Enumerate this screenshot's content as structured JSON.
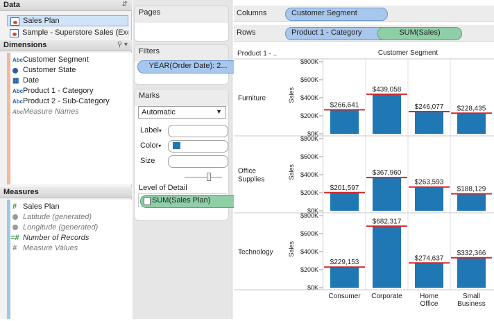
{
  "datapane": {
    "title": "Data",
    "sources": [
      {
        "label": "Sales Plan",
        "selected": true
      },
      {
        "label": "Sample - Superstore Sales (Exc..."
      }
    ],
    "dimensions_title": "Dimensions",
    "dimensions": [
      {
        "label": "Customer Segment",
        "icon": "Abc",
        "linked": true
      },
      {
        "label": "Customer State",
        "icon": "geo"
      },
      {
        "label": "Date",
        "icon": "date"
      },
      {
        "label": "Product 1 - Category",
        "icon": "Abc",
        "linked": true
      },
      {
        "label": "Product 2 - Sub-Category",
        "icon": "Abc"
      },
      {
        "label": "Measure Names",
        "icon": "Abc",
        "muted": true
      }
    ],
    "measures_title": "Measures",
    "measures": [
      {
        "label": "Sales Plan",
        "icon": "#"
      },
      {
        "label": "Latitude (generated)",
        "icon": "dot",
        "italic": true
      },
      {
        "label": "Longitude (generated)",
        "icon": "dot",
        "italic": true
      },
      {
        "label": "Number of Records",
        "icon": "=#",
        "italic": true
      },
      {
        "label": "Measure Values",
        "icon": "#",
        "italic": true
      }
    ]
  },
  "shelves": {
    "pages": "Pages",
    "filters": "Filters",
    "filter_pill": "YEAR(Order Date): 2...",
    "marks": "Marks",
    "mark_type": "Automatic",
    "label": "Label",
    "color": "Color",
    "size": "Size",
    "level_of_detail": "Level of Detail",
    "lod_pill": "SUM(Sales Plan)",
    "columns": "Columns",
    "columns_pill": "Customer Segment",
    "rows": "Rows",
    "rows_pill_1": "Product 1 - Category",
    "rows_pill_2": "SUM(Sales)"
  },
  "colors": {
    "bar": "#1f77b4",
    "ref_line": "#d62728"
  },
  "chart_data": {
    "type": "bar",
    "row_header": "Product 1 - ..",
    "column_header": "Customer Segment",
    "ylabel": "Sales",
    "ylim": [
      0,
      800000
    ],
    "yticks": [
      "$0K",
      "$200K",
      "$400K",
      "$600K",
      "$800K"
    ],
    "categories": [
      "Consumer",
      "Corporate",
      "Home Office",
      "Small Business"
    ],
    "rows": [
      {
        "name": "Furniture",
        "values": [
          266641,
          439058,
          246077,
          228435
        ],
        "labels": [
          "$266,641",
          "$439,058",
          "$246,077",
          "$228,435"
        ]
      },
      {
        "name": "Office Supplies",
        "values": [
          201597,
          367960,
          263593,
          188129
        ],
        "labels": [
          "$201,597",
          "$367,960",
          "$263,593",
          "$188,129"
        ]
      },
      {
        "name": "Technology",
        "values": [
          229153,
          682317,
          274637,
          332366
        ],
        "labels": [
          "$229,153",
          "$682,317",
          "$274,637",
          "$332,366"
        ]
      }
    ]
  }
}
